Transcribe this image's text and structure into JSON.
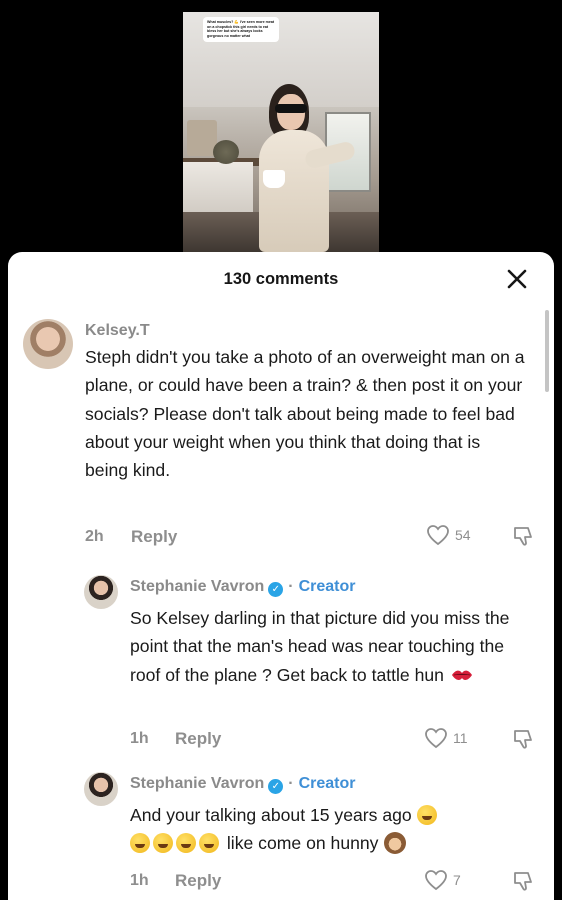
{
  "video": {
    "caption": "What muscles? 💪 I've seen more meat on a chopstick this girl needs to eat bless her but she's always looks gorgeous no matter what"
  },
  "sheet": {
    "comment_count": "130 comments",
    "close_icon": "close-icon"
  },
  "comments": [
    {
      "username": "Kelsey.T",
      "text": "Steph didn't you take a photo of an overweight man on a plane, or could have been a train? & then post it on your socials? Please don't talk about being made to feel bad about your weight when you think that doing that is being kind.",
      "time": "2h",
      "reply_label": "Reply",
      "likes": "54"
    },
    {
      "username": "Stephanie Vavron",
      "badge": "Creator",
      "text": "So Kelsey darling in that picture did you miss the point that the man's head was near touching the roof of the plane ? Get back to tattle hun",
      "emoji": "kiss-mark",
      "time": "1h",
      "reply_label": "Reply",
      "likes": "11"
    },
    {
      "username": "Stephanie Vavron",
      "badge": "Creator",
      "text_line1": "And your talking about 15 years ago",
      "text_line2": "like come on hunny",
      "emoji": "rolling-on-floor-laughing",
      "time": "1h",
      "reply_label": "Reply",
      "likes": "7"
    }
  ],
  "colors": {
    "creator_blue": "#3f8fd6",
    "verified_blue": "#2aa4e6",
    "meta_gray": "#8e8e8e"
  }
}
